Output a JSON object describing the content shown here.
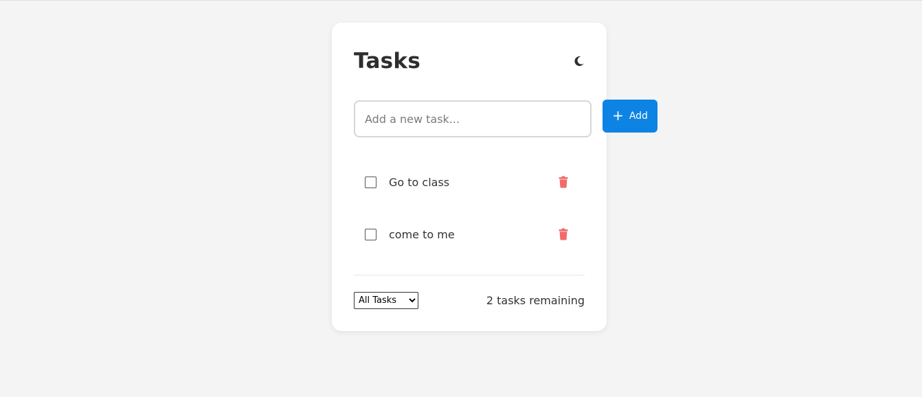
{
  "app": {
    "title": "Tasks"
  },
  "theme_toggle": {
    "icon": "moon-icon"
  },
  "new_task": {
    "placeholder": "Add a new task...",
    "value": ""
  },
  "add_button": {
    "icon": "plus-icon",
    "label": "Add"
  },
  "tasks": [
    {
      "text": "Go to class",
      "completed": false,
      "delete_icon": "trash-icon"
    },
    {
      "text": "come to me",
      "completed": false,
      "delete_icon": "trash-icon"
    }
  ],
  "footer": {
    "filter": {
      "selected": "All Tasks",
      "options": [
        "All Tasks"
      ]
    },
    "remaining_text": "2 tasks remaining"
  },
  "colors": {
    "accent": "#0d84e3",
    "delete": "#f26a6a",
    "background": "#f4f4f4",
    "card": "#ffffff"
  }
}
